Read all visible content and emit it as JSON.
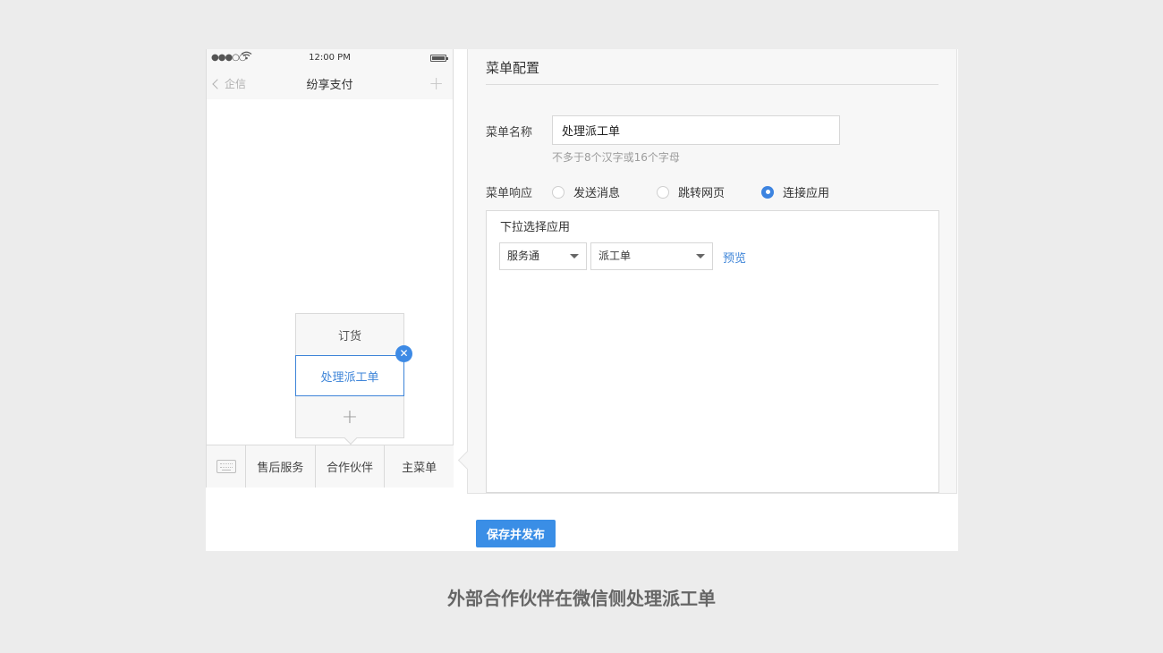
{
  "status_bar": {
    "signal": "●●●○○",
    "time": "12:00 PM"
  },
  "nav": {
    "back_label": "企信",
    "title": "纷享支付",
    "plus": "+"
  },
  "submenu": {
    "items": [
      {
        "label": "订货"
      },
      {
        "label": "处理派工单"
      }
    ],
    "add": "+",
    "close": "✕"
  },
  "tabbar": {
    "tabs": [
      {
        "label": "售后服务"
      },
      {
        "label": "合作伙伴"
      },
      {
        "label": "主菜单"
      }
    ]
  },
  "panel": {
    "title": "菜单配置",
    "name_label": "菜单名称",
    "name_value": "处理派工单",
    "name_hint": "不多于8个汉字或16个字母",
    "response_label": "菜单响应",
    "options": [
      {
        "label": "发送消息",
        "checked": false
      },
      {
        "label": "跳转网页",
        "checked": false
      },
      {
        "label": "连接应用",
        "checked": true
      }
    ],
    "app_box": {
      "title": "下拉选择应用",
      "select1": "服务通",
      "select2": "派工单",
      "preview": "预览"
    }
  },
  "save_button": "保存并发布",
  "caption": "外部合作伙伴在微信侧处理派工单",
  "colors": {
    "accent": "#3d84d8",
    "button": "#3a8ee6"
  }
}
